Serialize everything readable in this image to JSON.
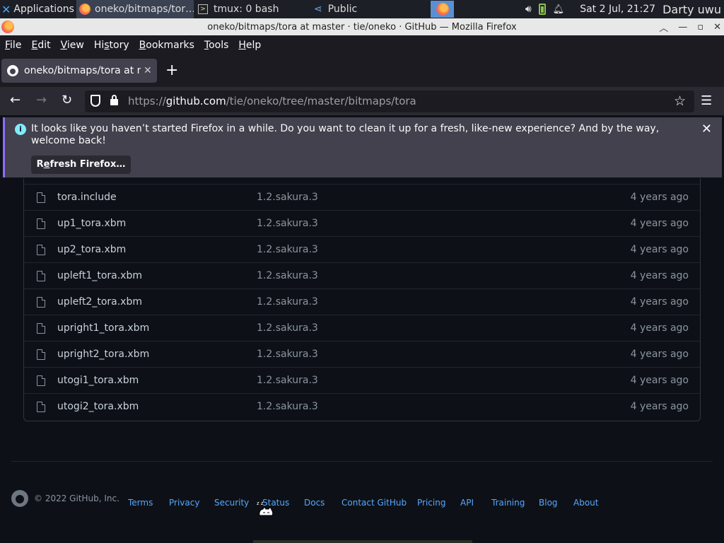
{
  "panel": {
    "applications_label": "Applications",
    "tasks": [
      {
        "label": "oneko/bitmaps/tor…",
        "icon": "firefox-icon",
        "active": true
      },
      {
        "label": "tmux: 0 bash",
        "icon": "terminal-icon",
        "active": false
      },
      {
        "label": "Public",
        "icon": "share-icon",
        "active": false
      }
    ],
    "clock": "Sat  2 Jul, 21:27",
    "user": "Darty uwu"
  },
  "window": {
    "title": "oneko/bitmaps/tora at master · tie/oneko · GitHub — Mozilla Firefox"
  },
  "menubar": {
    "items": [
      {
        "pre": "",
        "u": "F",
        "post": "ile"
      },
      {
        "pre": "",
        "u": "E",
        "post": "dit"
      },
      {
        "pre": "",
        "u": "V",
        "post": "iew"
      },
      {
        "pre": "Hi",
        "u": "s",
        "post": "tory"
      },
      {
        "pre": "",
        "u": "B",
        "post": "ookmarks"
      },
      {
        "pre": "",
        "u": "T",
        "post": "ools"
      },
      {
        "pre": "",
        "u": "H",
        "post": "elp"
      }
    ]
  },
  "tab": {
    "title": "oneko/bitmaps/tora at master · tie/oneko"
  },
  "urlbar": {
    "url_prefix": "https://",
    "url_host": "github.com",
    "url_path": "/tie/oneko/tree/master/bitmaps/tora"
  },
  "notification": {
    "message": "It looks like you haven’t started Firefox in a while. Do you want to clean it up for a fresh, like-new experience? And by the way, welcome back!",
    "button_pre": "R",
    "button_u": "e",
    "button_post": "fresh Firefox…"
  },
  "files": [
    {
      "name": "tora.include",
      "commit": "1.2.sakura.3",
      "age": "4 years ago"
    },
    {
      "name": "up1_tora.xbm",
      "commit": "1.2.sakura.3",
      "age": "4 years ago"
    },
    {
      "name": "up2_tora.xbm",
      "commit": "1.2.sakura.3",
      "age": "4 years ago"
    },
    {
      "name": "upleft1_tora.xbm",
      "commit": "1.2.sakura.3",
      "age": "4 years ago"
    },
    {
      "name": "upleft2_tora.xbm",
      "commit": "1.2.sakura.3",
      "age": "4 years ago"
    },
    {
      "name": "upright1_tora.xbm",
      "commit": "1.2.sakura.3",
      "age": "4 years ago"
    },
    {
      "name": "upright2_tora.xbm",
      "commit": "1.2.sakura.3",
      "age": "4 years ago"
    },
    {
      "name": "utogi1_tora.xbm",
      "commit": "1.2.sakura.3",
      "age": "4 years ago"
    },
    {
      "name": "utogi2_tora.xbm",
      "commit": "1.2.sakura.3",
      "age": "4 years ago"
    }
  ],
  "footer": {
    "copyright": "© 2022 GitHub, Inc.",
    "links": [
      "Terms",
      "Privacy",
      "Security",
      "Status",
      "Docs",
      "Contact GitHub",
      "Pricing",
      "API",
      "Training",
      "Blog",
      "About"
    ]
  },
  "colors": {
    "page_bg": "#0d1117",
    "link": "#58a6ff",
    "muted_text": "#8b949e",
    "file_text": "#c9d1d9",
    "notification_accent": "#8f6cff"
  }
}
